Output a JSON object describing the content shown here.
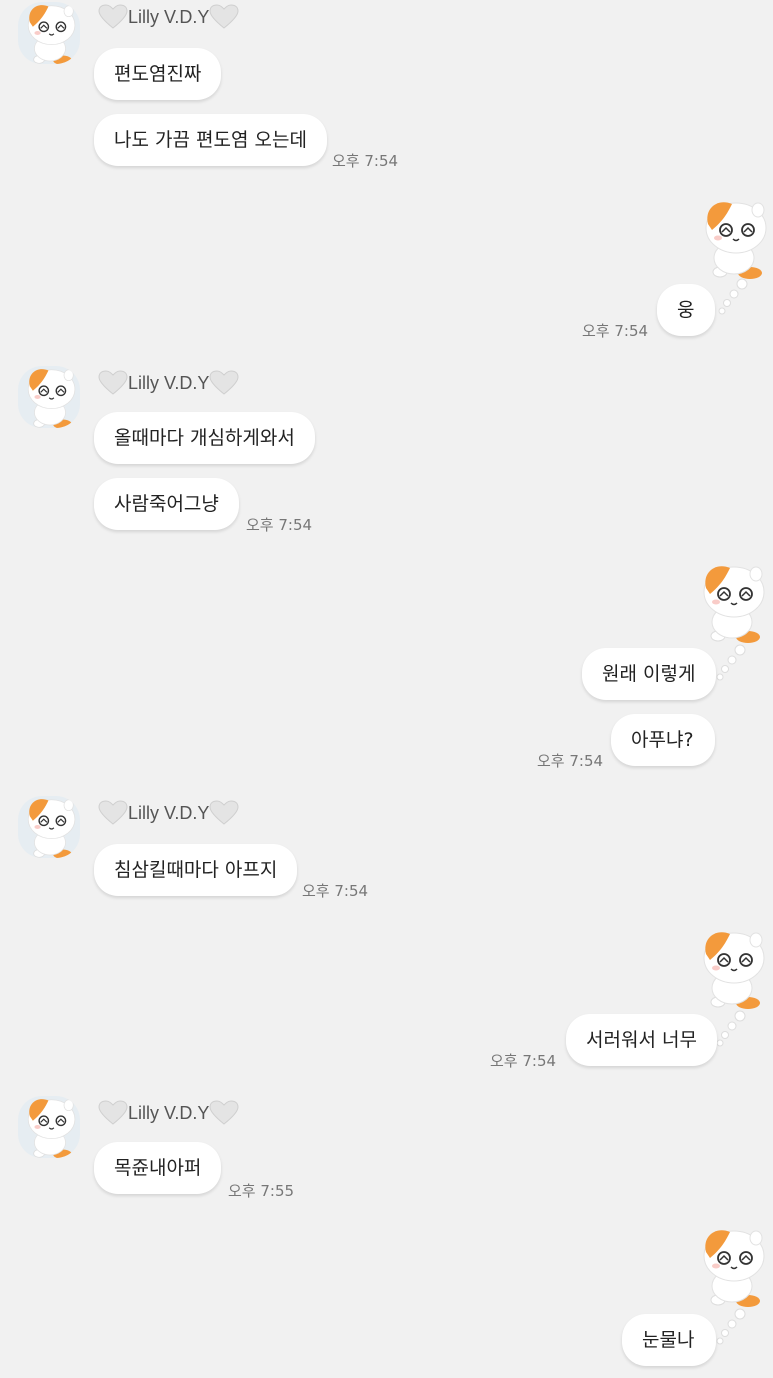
{
  "messages": [
    {
      "type": "received",
      "avatar": "hamster-avatar",
      "sender": "Lilly V.D.Y",
      "bubbles": [
        "편도염진짜",
        "나도 가끔 편도염 오는데"
      ],
      "time": "오후 7:54"
    },
    {
      "type": "sent",
      "sticker": "hamster-sticker",
      "bubbles": [
        "웅"
      ],
      "time": "오후 7:54"
    },
    {
      "type": "received",
      "avatar": "hamster-avatar",
      "sender": "Lilly V.D.Y",
      "bubbles": [
        "올때마다 개심하게와서",
        "사람죽어그냥"
      ],
      "time": "오후 7:54"
    },
    {
      "type": "sent",
      "sticker": "hamster-sticker",
      "bubbles": [
        "원래 이렇게",
        "아푸냐?"
      ],
      "time": "오후 7:54"
    },
    {
      "type": "received",
      "avatar": "hamster-avatar",
      "sender": "Lilly V.D.Y",
      "bubbles": [
        "침삼킬때마다 아프지"
      ],
      "time": "오후 7:54"
    },
    {
      "type": "sent",
      "sticker": "hamster-sticker",
      "bubbles": [
        "서러워서 너무"
      ],
      "time": "오후 7:54"
    },
    {
      "type": "received",
      "avatar": "hamster-avatar",
      "sender": "Lilly V.D.Y",
      "bubbles": [
        "목쥰내아퍼"
      ],
      "time": "오후 7:55"
    },
    {
      "type": "sent",
      "sticker": "hamster-sticker",
      "bubbles": [
        "눈물나"
      ],
      "time": ""
    }
  ],
  "colors": {
    "background": "#f1f1f1",
    "bubble": "#ffffff",
    "hamster_orange": "#f39a3c"
  }
}
